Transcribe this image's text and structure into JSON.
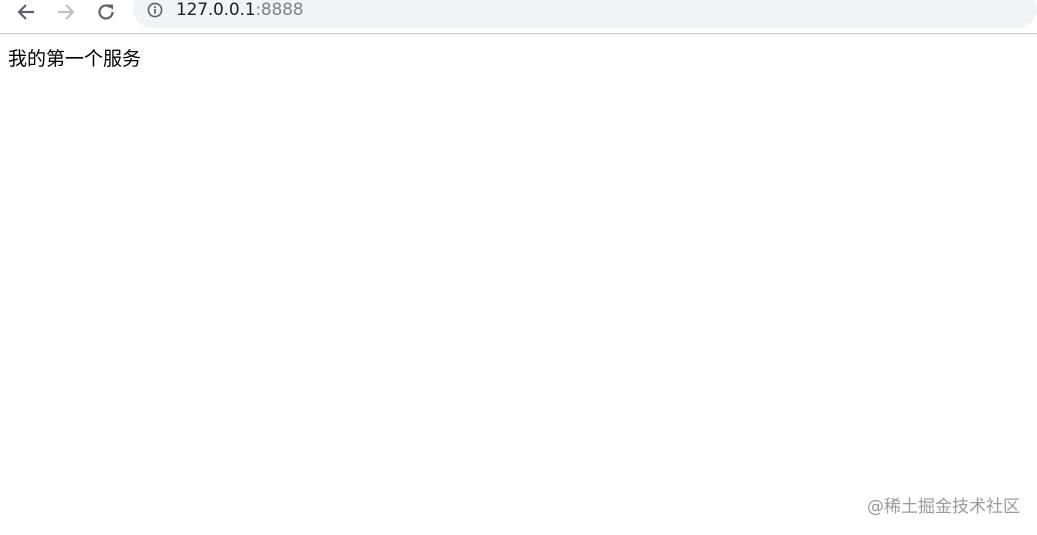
{
  "toolbar": {
    "back_icon": "arrow-left-icon",
    "forward_icon": "arrow-right-icon",
    "reload_icon": "reload-icon",
    "info_icon": "info-icon"
  },
  "address_bar": {
    "host": "127.0.0.1",
    "port": ":8888"
  },
  "page": {
    "body_text": "我的第一个服务"
  },
  "watermark": {
    "text": "@稀土掘金技术社区"
  },
  "colors": {
    "icon_active": "#5f6368",
    "icon_disabled": "#bdc1c6",
    "omnibox_bg": "#f1f3f4",
    "url_host": "#202124",
    "url_port": "#80868b",
    "watermark": "#9a9a9a"
  }
}
